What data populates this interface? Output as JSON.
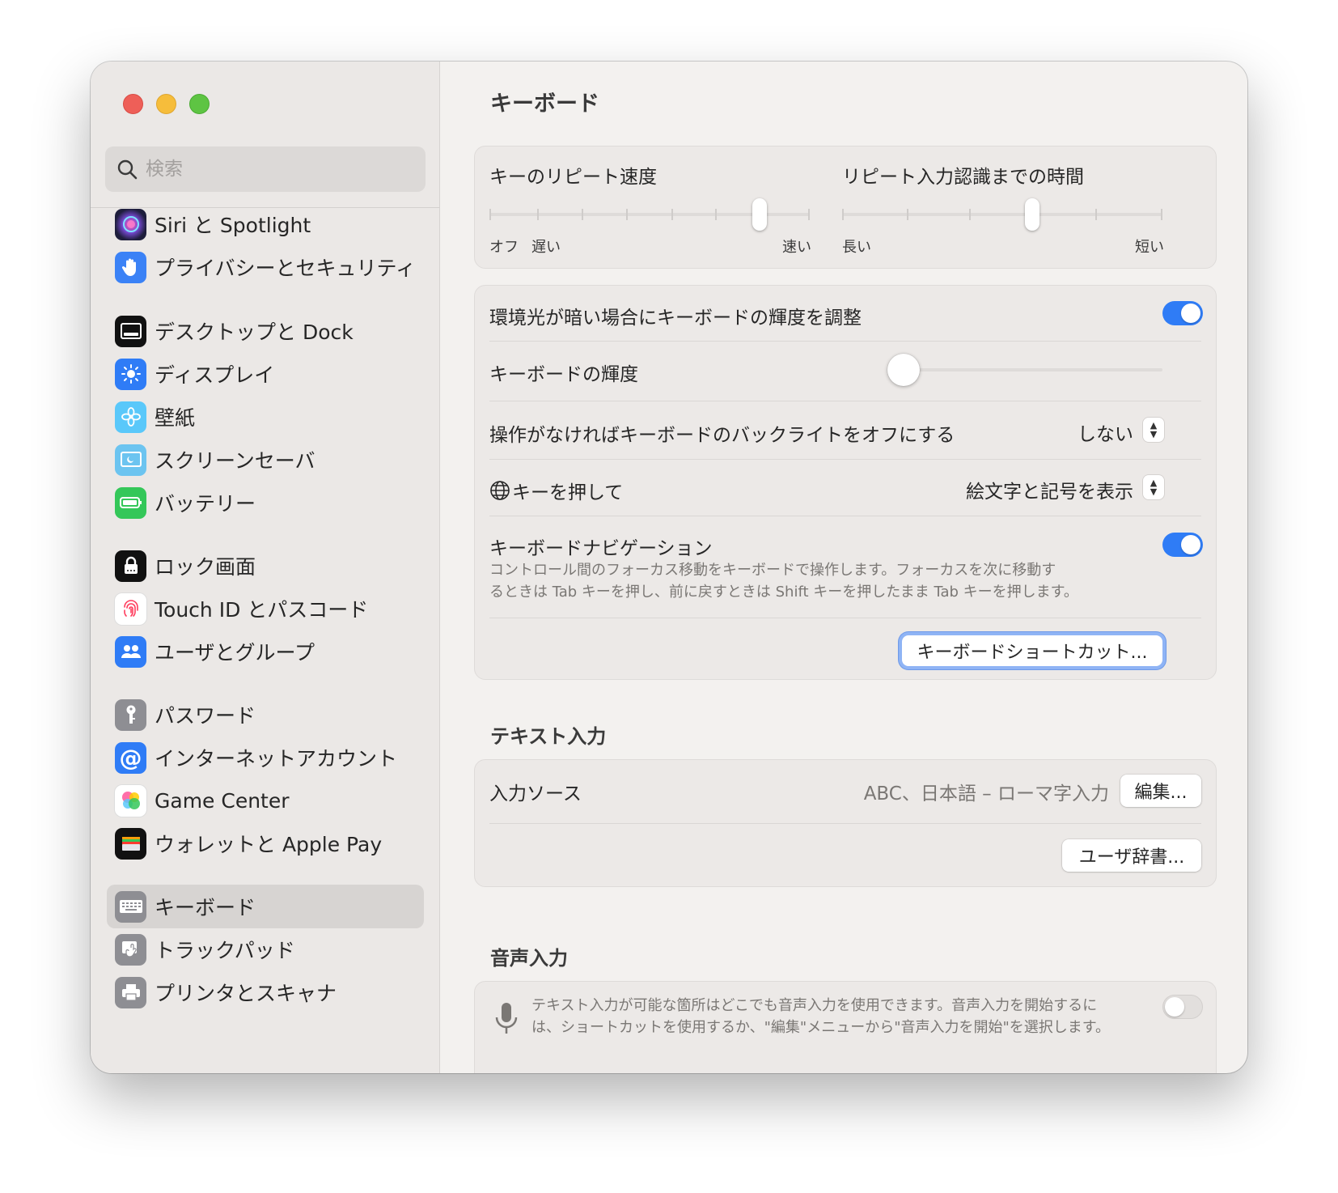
{
  "window": {
    "title": "キーボード"
  },
  "search": {
    "placeholder": "検索"
  },
  "sidebar": {
    "items": [
      {
        "label": "Siri と Spotlight",
        "icon": "siri-icon",
        "color": "#4a3a8c"
      },
      {
        "label": "プライバシーとセキュリティ",
        "icon": "hand-icon",
        "color": "#3b82f6"
      },
      {
        "label": "デスクトップと Dock",
        "icon": "dock-icon",
        "color": "#111111"
      },
      {
        "label": "ディスプレイ",
        "icon": "sun-icon",
        "color": "#2f7cf6"
      },
      {
        "label": "壁紙",
        "icon": "flower-icon",
        "color": "#5ac8fa"
      },
      {
        "label": "スクリーンセーバ",
        "icon": "screensaver-icon",
        "color": "#6cc4f0"
      },
      {
        "label": "バッテリー",
        "icon": "battery-icon",
        "color": "#34c759"
      },
      {
        "label": "ロック画面",
        "icon": "lock-icon",
        "color": "#111111"
      },
      {
        "label": "Touch ID とパスコード",
        "icon": "fingerprint-icon",
        "color": "#ffffff"
      },
      {
        "label": "ユーザとグループ",
        "icon": "users-icon",
        "color": "#2f7cf6"
      },
      {
        "label": "パスワード",
        "icon": "key-icon",
        "color": "#8e8e93"
      },
      {
        "label": "インターネットアカウント",
        "icon": "at-icon",
        "color": "#2f7cf6"
      },
      {
        "label": "Game Center",
        "icon": "game-center-icon",
        "color": "#ffffff"
      },
      {
        "label": "ウォレットと Apple Pay",
        "icon": "wallet-icon",
        "color": "#111111"
      },
      {
        "label": "キーボード",
        "icon": "keyboard-icon",
        "color": "#8e8e93",
        "selected": true
      },
      {
        "label": "トラックパッド",
        "icon": "trackpad-icon",
        "color": "#8e8e93"
      },
      {
        "label": "プリンタとスキャナ",
        "icon": "printer-icon",
        "color": "#8e8e93"
      }
    ]
  },
  "repeat": {
    "rate_label": "キーのリピート速度",
    "rate_min1": "オフ",
    "rate_min2": "遅い",
    "rate_max": "速い",
    "rate_value_fraction": 0.85,
    "delay_label": "リピート入力認識までの時間",
    "delay_min": "長い",
    "delay_max": "短い",
    "delay_value_fraction": 0.6
  },
  "lighting": {
    "ambient_label": "環境光が暗い場合にキーボードの輝度を調整",
    "ambient_on": true,
    "brightness_label": "キーボードの輝度",
    "brightness_value": 0,
    "backlight_off_label": "操作がなければキーボードのバックライトをオフにする",
    "backlight_off_value": "しない",
    "globe_label": "キーを押して",
    "globe_value": "絵文字と記号を表示",
    "nav_label": "キーボードナビゲーション",
    "nav_desc_line1": "コントロール間のフォーカス移動をキーボードで操作します。フォーカスを次に移動す",
    "nav_desc_line2": "るときは Tab キーを押し、前に戻すときは Shift キーを押したまま Tab キーを押します。",
    "nav_on": true,
    "shortcuts_button": "キーボードショートカット..."
  },
  "text_input": {
    "section_title": "テキスト入力",
    "source_label": "入力ソース",
    "source_value": "ABC、日本語 – ローマ字入力",
    "edit_button": "編集...",
    "dictionary_button": "ユーザ辞書..."
  },
  "dictation": {
    "section_title": "音声入力",
    "desc_line1": "テキスト入力が可能な箇所はどこでも音声入力を使用できます。音声入力を開始するに",
    "desc_line2": "は、ショートカットを使用するか、\"編集\"メニューから\"音声入力を開始\"を選択します。",
    "enabled": false
  }
}
